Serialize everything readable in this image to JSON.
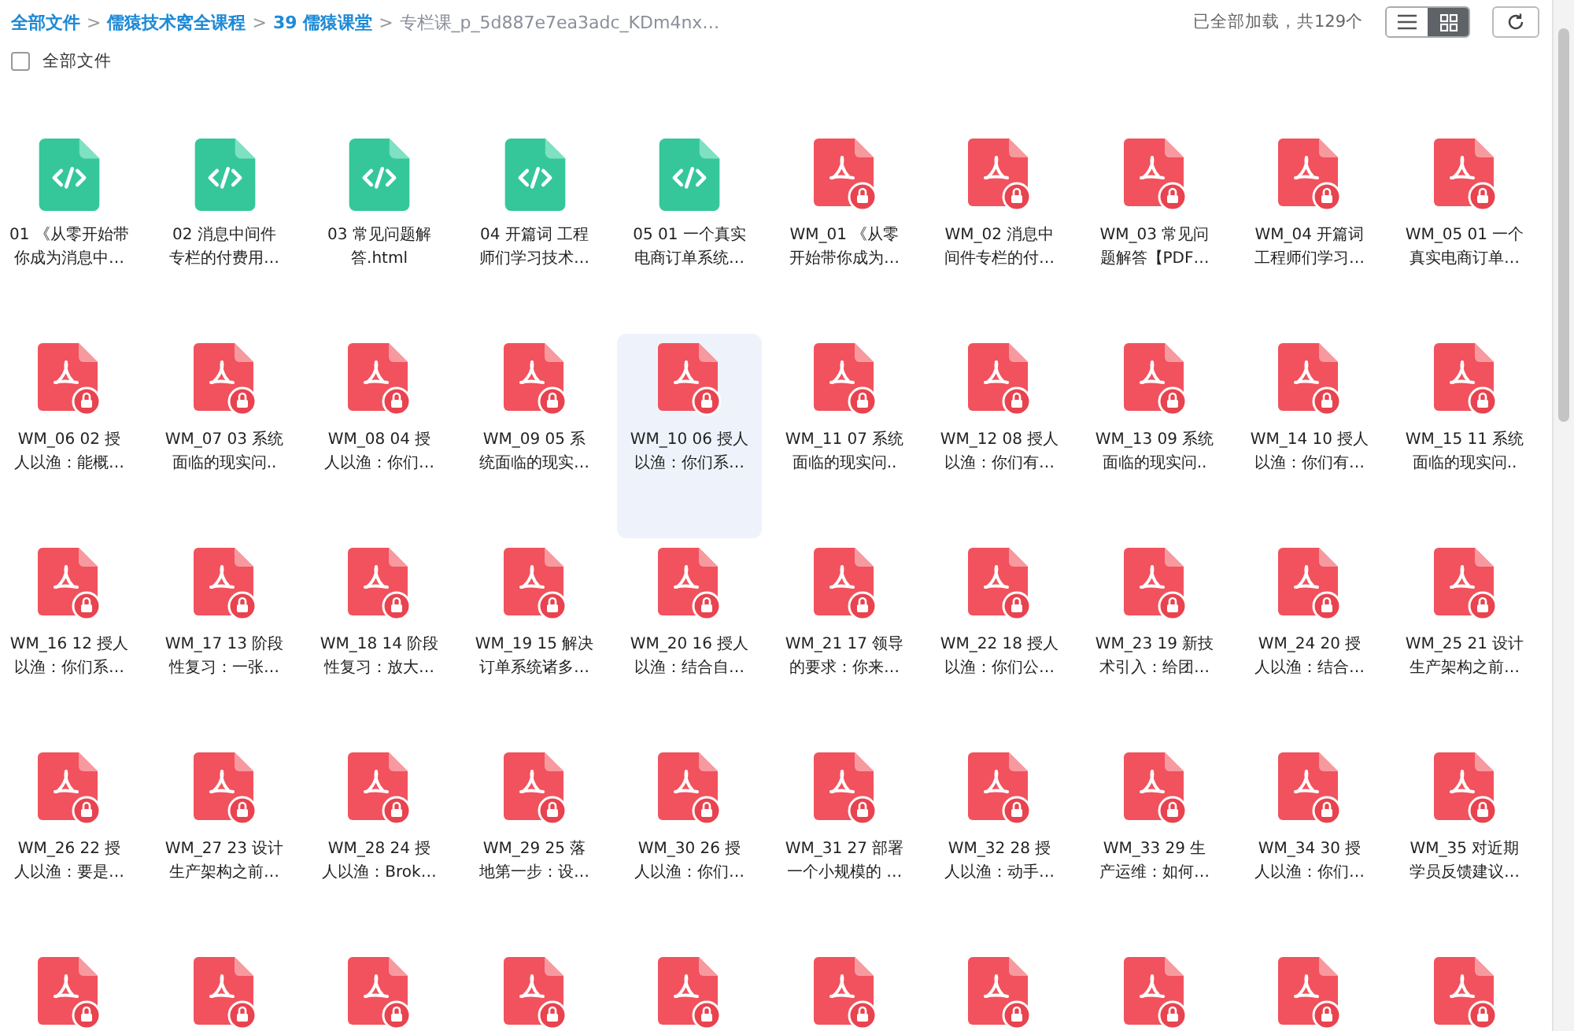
{
  "breadcrumb": [
    {
      "label": "全部文件",
      "current": false
    },
    {
      "label": "儒猿技术窝全课程",
      "current": false
    },
    {
      "label": "39 儒猿课堂",
      "current": false
    },
    {
      "label": "专栏课_p_5d887e7ea3adc_KDm4nx…",
      "current": true
    }
  ],
  "separator": ">",
  "status": "已全部加载，共129个",
  "view_modes": [
    {
      "kind": "list",
      "selected": false
    },
    {
      "kind": "grid",
      "selected": true
    }
  ],
  "select_all": {
    "label": "全部文件",
    "checked": false
  },
  "files": [
    {
      "kind": "html",
      "selected": false,
      "lines": [
        "01 《从零开始带",
        "你成为消息中…"
      ]
    },
    {
      "kind": "html",
      "selected": false,
      "lines": [
        "02 消息中间件",
        "专栏的付费用…"
      ]
    },
    {
      "kind": "html",
      "selected": false,
      "lines": [
        "03 常见问题解",
        "答.html"
      ]
    },
    {
      "kind": "html",
      "selected": false,
      "lines": [
        "04 开篇词 工程",
        "师们学习技术…"
      ]
    },
    {
      "kind": "html",
      "selected": false,
      "lines": [
        "05 01 一个真实",
        "电商订单系统…"
      ]
    },
    {
      "kind": "pdf",
      "selected": false,
      "lines": [
        "WM_01 《从零",
        "开始带你成为…"
      ]
    },
    {
      "kind": "pdf",
      "selected": false,
      "lines": [
        "WM_02 消息中",
        "间件专栏的付…"
      ]
    },
    {
      "kind": "pdf",
      "selected": false,
      "lines": [
        "WM_03 常见问",
        "题解答【PDF…"
      ]
    },
    {
      "kind": "pdf",
      "selected": false,
      "lines": [
        "WM_04 开篇词",
        "工程师们学习…"
      ]
    },
    {
      "kind": "pdf",
      "selected": false,
      "lines": [
        "WM_05 01 一个",
        "真实电商订单…"
      ]
    },
    {
      "kind": "pdf",
      "selected": false,
      "lines": [
        "WM_06 02 授",
        "人以渔：能概…"
      ]
    },
    {
      "kind": "pdf",
      "selected": false,
      "lines": [
        "WM_07 03 系统",
        "面临的现实问.."
      ]
    },
    {
      "kind": "pdf",
      "selected": false,
      "lines": [
        "WM_08 04 授",
        "人以渔：你们…"
      ]
    },
    {
      "kind": "pdf",
      "selected": false,
      "lines": [
        "WM_09 05 系",
        "统面临的现实…"
      ]
    },
    {
      "kind": "pdf",
      "selected": true,
      "lines": [
        "WM_10 06 授人",
        "以渔：你们系…"
      ]
    },
    {
      "kind": "pdf",
      "selected": false,
      "lines": [
        "WM_11 07 系统",
        "面临的现实问.."
      ]
    },
    {
      "kind": "pdf",
      "selected": false,
      "lines": [
        "WM_12 08 授人",
        "以渔：你们有…"
      ]
    },
    {
      "kind": "pdf",
      "selected": false,
      "lines": [
        "WM_13 09 系统",
        "面临的现实问.."
      ]
    },
    {
      "kind": "pdf",
      "selected": false,
      "lines": [
        "WM_14 10 授人",
        "以渔：你们有…"
      ]
    },
    {
      "kind": "pdf",
      "selected": false,
      "lines": [
        "WM_15 11 系统",
        "面临的现实问.."
      ]
    },
    {
      "kind": "pdf",
      "selected": false,
      "lines": [
        "WM_16 12 授人",
        "以渔：你们系…"
      ]
    },
    {
      "kind": "pdf",
      "selected": false,
      "lines": [
        "WM_17 13 阶段",
        "性复习：一张…"
      ]
    },
    {
      "kind": "pdf",
      "selected": false,
      "lines": [
        "WM_18 14 阶段",
        "性复习：放大…"
      ]
    },
    {
      "kind": "pdf",
      "selected": false,
      "lines": [
        "WM_19 15 解决",
        "订单系统诸多…"
      ]
    },
    {
      "kind": "pdf",
      "selected": false,
      "lines": [
        "WM_20 16 授人",
        "以渔：结合自…"
      ]
    },
    {
      "kind": "pdf",
      "selected": false,
      "lines": [
        "WM_21 17 领导",
        "的要求：你来…"
      ]
    },
    {
      "kind": "pdf",
      "selected": false,
      "lines": [
        "WM_22 18 授人",
        "以渔：你们公…"
      ]
    },
    {
      "kind": "pdf",
      "selected": false,
      "lines": [
        "WM_23 19 新技",
        "术引入：给团…"
      ]
    },
    {
      "kind": "pdf",
      "selected": false,
      "lines": [
        "WM_24 20 授",
        "人以渔：结合…"
      ]
    },
    {
      "kind": "pdf",
      "selected": false,
      "lines": [
        "WM_25 21 设计",
        "生产架构之前…"
      ]
    },
    {
      "kind": "pdf",
      "selected": false,
      "lines": [
        "WM_26 22 授",
        "人以渔：要是…"
      ]
    },
    {
      "kind": "pdf",
      "selected": false,
      "lines": [
        "WM_27 23 设计",
        "生产架构之前…"
      ]
    },
    {
      "kind": "pdf",
      "selected": false,
      "lines": [
        "WM_28 24 授",
        "人以渔：Brok…"
      ]
    },
    {
      "kind": "pdf",
      "selected": false,
      "lines": [
        "WM_29 25 落",
        "地第一步：设…"
      ]
    },
    {
      "kind": "pdf",
      "selected": false,
      "lines": [
        "WM_30 26 授",
        "人以渔：你们…"
      ]
    },
    {
      "kind": "pdf",
      "selected": false,
      "lines": [
        "WM_31 27 部署",
        "一个小规模的 …"
      ]
    },
    {
      "kind": "pdf",
      "selected": false,
      "lines": [
        "WM_32 28 授",
        "人以渔：动手…"
      ]
    },
    {
      "kind": "pdf",
      "selected": false,
      "lines": [
        "WM_33 29 生",
        "产运维：如何…"
      ]
    },
    {
      "kind": "pdf",
      "selected": false,
      "lines": [
        "WM_34 30 授",
        "人以渔：你们…"
      ]
    },
    {
      "kind": "pdf",
      "selected": false,
      "lines": [
        "WM_35 对近期",
        "学员反馈建议…"
      ]
    },
    {
      "kind": "pdf",
      "selected": false
    },
    {
      "kind": "pdf",
      "selected": false
    },
    {
      "kind": "pdf",
      "selected": false
    },
    {
      "kind": "pdf",
      "selected": false
    },
    {
      "kind": "pdf",
      "selected": false
    },
    {
      "kind": "pdf",
      "selected": false
    },
    {
      "kind": "pdf",
      "selected": false
    },
    {
      "kind": "pdf",
      "selected": false
    },
    {
      "kind": "pdf",
      "selected": false
    },
    {
      "kind": "pdf",
      "selected": false
    }
  ]
}
